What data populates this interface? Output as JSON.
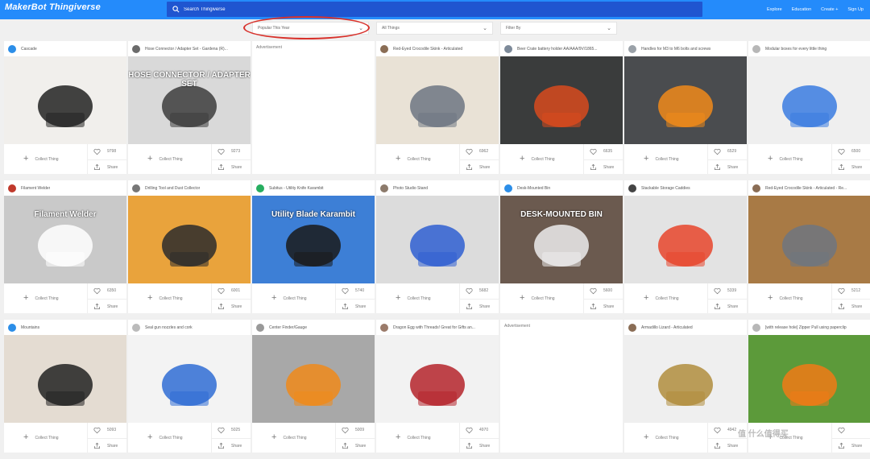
{
  "header": {
    "logo": "MakerBot Thingiverse",
    "search_placeholder": "Search Thingiverse",
    "nav": [
      "Explore",
      "Education",
      "Create +",
      "Sign Up"
    ]
  },
  "filters": [
    {
      "label": "Popular This Year"
    },
    {
      "label": "All Things"
    },
    {
      "label": "Filter By"
    }
  ],
  "actions": {
    "collect": "Collect Thing",
    "share": "Share"
  },
  "ad_label": "Advertisement",
  "cards": [
    {
      "title": "Cascade",
      "likes": "9798",
      "avatar": "#2c8ee8",
      "ad": false,
      "bg": "#f1efec",
      "fg": "#222"
    },
    {
      "title": "Hose Connector / Adapter Set - Gardena (R)...",
      "likes": "9273",
      "avatar": "#6b6b6b",
      "ad": false,
      "bg": "#d9d9d9",
      "fg": "#3c3c3c",
      "caption": "HOSE CONNECTOR / ADAPTER SET"
    },
    {
      "ad": true
    },
    {
      "title": "Red-Eyed Crocodile Skink - Articulated",
      "likes": "6962",
      "avatar": "#8a6d55",
      "ad": false,
      "bg": "#e9e2d6",
      "fg": "#6d7683"
    },
    {
      "title": "Beer Crate battery holder AA/AAA/9V/1865...",
      "likes": "6635",
      "avatar": "#7d8a99",
      "ad": false,
      "bg": "#3a3c3c",
      "fg": "#d84a1d"
    },
    {
      "title": "Handles for M3 to M6 bolts and screws",
      "likes": "6529",
      "avatar": "#9aa1a8",
      "ad": false,
      "bg": "#4a4c4f",
      "fg": "#f08a1a"
    },
    {
      "title": "Modular boxes for every little thing",
      "likes": "6500",
      "avatar": "#b7b7b7",
      "ad": false,
      "bg": "#efefef",
      "fg": "#3a7be0"
    },
    {
      "title": "Filament Welder",
      "likes": "6350",
      "avatar": "#c0392b",
      "ad": false,
      "bg": "#c9c9c9",
      "fg": "#ffffff",
      "caption": "Filament Welder"
    },
    {
      "title": "Drilling Tool and Dust Collector",
      "likes": "6001",
      "avatar": "#777777",
      "ad": false,
      "bg": "#e9a33c",
      "fg": "#2c2c2c"
    },
    {
      "title": "Subitus - Utility Knife Karambit",
      "likes": "5740",
      "avatar": "#27ae60",
      "ad": false,
      "bg": "#3d7fd6",
      "fg": "#1a1a1a",
      "caption": "Utility Blade Karambit"
    },
    {
      "title": "Photo Studio Stand",
      "likes": "5682",
      "avatar": "#8c7a6b",
      "ad": false,
      "bg": "#dcdcdc",
      "fg": "#2f5fd1"
    },
    {
      "title": "Desk-Mounted Bin",
      "likes": "5600",
      "avatar": "#2c8ee8",
      "ad": false,
      "bg": "#6b5a4f",
      "fg": "#ececec",
      "caption": "DESK-MOUNTED BIN"
    },
    {
      "title": "Stackable Storage Caddies",
      "likes": "5339",
      "avatar": "#444444",
      "ad": false,
      "bg": "#e3e3e3",
      "fg": "#e8452c"
    },
    {
      "title": "Red-Eyed Crocodile Skink - Articulated - Re...",
      "likes": "5212",
      "avatar": "#8a6d55",
      "ad": false,
      "bg": "#a87a45",
      "fg": "#6f7680"
    },
    {
      "title": "Mountains",
      "likes": "5093",
      "avatar": "#2c8ee8",
      "ad": false,
      "bg": "#e4dcd2",
      "fg": "#222"
    },
    {
      "title": "Seal gun nozzles and cork",
      "likes": "5025",
      "avatar": "#bbbbbb",
      "ad": false,
      "bg": "#f3f3f3",
      "fg": "#2f6cd4"
    },
    {
      "title": "Center Finder/Gauge",
      "likes": "5009",
      "avatar": "#999999",
      "ad": false,
      "bg": "#a8a8a8",
      "fg": "#f08a1a"
    },
    {
      "title": "Dragon Egg with Threads! Great for Gifts an...",
      "likes": "4970",
      "avatar": "#9b7b6a",
      "ad": false,
      "bg": "#f2f2f2",
      "fg": "#b5252b"
    },
    {
      "ad": true
    },
    {
      "title": "Armadillo Lizard - Articulated",
      "likes": "4942",
      "avatar": "#8a6d55",
      "ad": false,
      "bg": "#efefef",
      "fg": "#b08d3d"
    },
    {
      "title": "[with release hole] Zipper Pull using paperclip",
      "likes": "",
      "avatar": "#b7b7b7",
      "ad": false,
      "bg": "#5c9a3a",
      "fg": "#f07a16"
    }
  ]
}
